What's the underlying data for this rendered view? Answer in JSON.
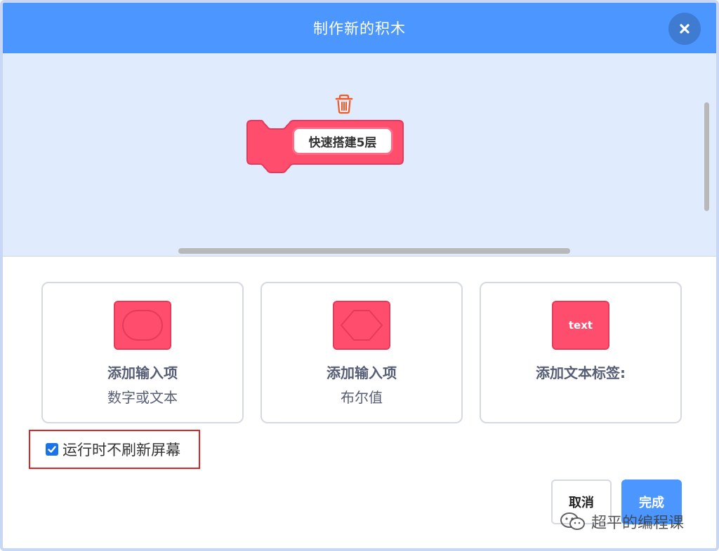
{
  "dialog": {
    "title": "制作新的积木",
    "close_icon": "close-icon"
  },
  "workspace": {
    "block_label": "快速搭建5层",
    "block_color": "#ff4d6d",
    "trash_icon": "trash-icon"
  },
  "options": [
    {
      "title": "添加输入项",
      "subtitle": "数字或文本",
      "icon": "round-input-icon"
    },
    {
      "title": "添加输入项",
      "subtitle": "布尔值",
      "icon": "boolean-input-icon"
    },
    {
      "title": "添加文本标签:",
      "subtitle": "",
      "icon": "text-label-icon",
      "icon_text": "text"
    }
  ],
  "run_without_refresh": {
    "label": "运行时不刷新屏幕",
    "checked": true
  },
  "buttons": {
    "cancel": "取消",
    "ok": "完成"
  },
  "watermark": {
    "text": "超平的编程课"
  },
  "colors": {
    "header": "#4c97ff",
    "workspace_bg": "#e0ebfd",
    "block": "#ff4d6d",
    "highlight_border": "#e02424"
  }
}
